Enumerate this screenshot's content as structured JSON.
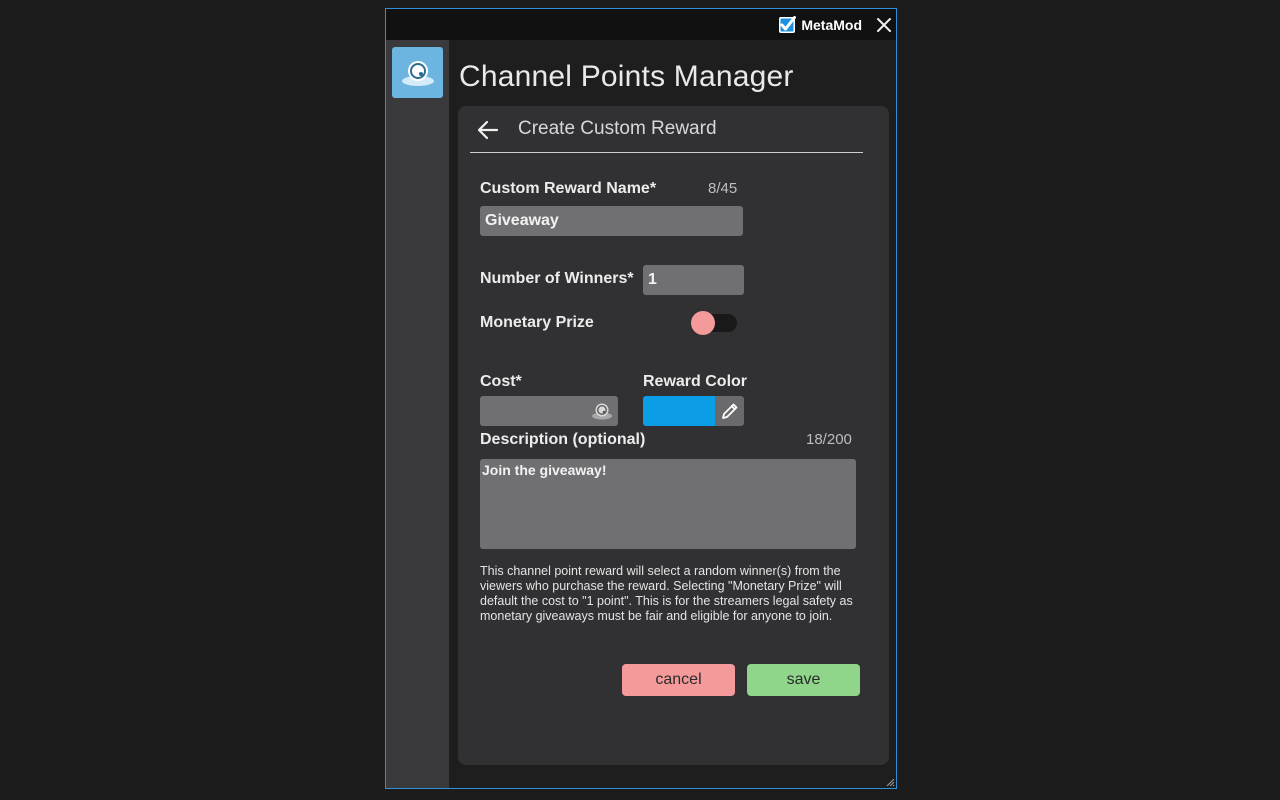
{
  "window": {
    "brand_label": "MetaMod",
    "accent_color": "#2f8fd6"
  },
  "sidebar": {
    "items": [
      {
        "icon": "channel-points-icon",
        "active": true
      }
    ]
  },
  "page": {
    "title": "Channel Points Manager"
  },
  "form": {
    "header_title": "Create Custom Reward",
    "reward_name": {
      "label": "Custom Reward Name*",
      "counter": "8/45",
      "value": "Giveaway"
    },
    "winners": {
      "label": "Number of Winners*",
      "value": "1"
    },
    "monetary_prize": {
      "label": "Monetary Prize",
      "enabled": false
    },
    "cost": {
      "label": "Cost*",
      "value": "",
      "icon": "channel-points-icon"
    },
    "reward_color": {
      "label": "Reward Color",
      "value": "#0b9ee6",
      "icon": "pencil-icon"
    },
    "description": {
      "label": "Description (optional)",
      "counter": "18/200",
      "value": "Join the giveaway!"
    },
    "help_text": "This channel point reward will select a random winner(s) from the viewers who purchase the reward. Selecting \"Monetary Prize\" will default the cost to \"1 point\". This is for the streamers legal safety as monetary giveaways must be fair and eligible for anyone to join.",
    "cancel_label": "cancel",
    "save_label": "save"
  },
  "colors": {
    "cancel": "#f59a9a",
    "save": "#8fd58a",
    "toggle_off_knob": "#f59a9a"
  }
}
